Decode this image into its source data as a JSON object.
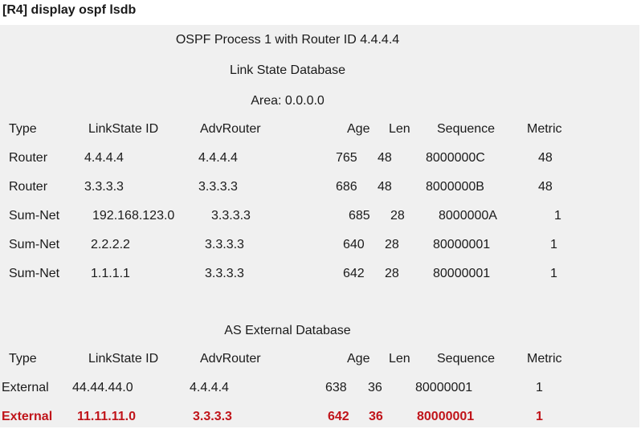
{
  "command": "[R4] display ospf lsdb",
  "header": {
    "process_line": "OSPF Process 1 with Router ID 4.4.4.4",
    "lsdb_title": "Link State Database",
    "area": "Area: 0.0.0.0"
  },
  "columns": {
    "type": "Type",
    "ls_id": "LinkState ID",
    "adv_router": "AdvRouter",
    "age": "Age",
    "len": "Len",
    "sequence": "Sequence",
    "metric": "Metric"
  },
  "area_rows": [
    {
      "type": "Router",
      "ls_id": "4.4.4.4",
      "adv_router": "4.4.4.4",
      "age": "765",
      "len": "48",
      "sequence": "8000000C",
      "metric": "48"
    },
    {
      "type": "Router",
      "ls_id": "3.3.3.3",
      "adv_router": "3.3.3.3",
      "age": "686",
      "len": "48",
      "sequence": "8000000B",
      "metric": "48"
    },
    {
      "type": "Sum-Net",
      "ls_id": "192.168.123.0",
      "adv_router": "3.3.3.3",
      "age": "685",
      "len": "28",
      "sequence": "8000000A",
      "metric": "1"
    },
    {
      "type": "Sum-Net",
      "ls_id": "2.2.2.2",
      "adv_router": "3.3.3.3",
      "age": "640",
      "len": "28",
      "sequence": "80000001",
      "metric": "1"
    },
    {
      "type": "Sum-Net",
      "ls_id": "1.1.1.1",
      "adv_router": "3.3.3.3",
      "age": "642",
      "len": "28",
      "sequence": "80000001",
      "metric": "1"
    }
  ],
  "external": {
    "title": "AS External Database",
    "rows": [
      {
        "type": "External",
        "ls_id": "44.44.44.0",
        "adv_router": "4.4.4.4",
        "age": "638",
        "len": "36",
        "sequence": "80000001",
        "metric": "1",
        "highlight": false
      },
      {
        "type": "External",
        "ls_id": "11.11.11.0",
        "adv_router": "3.3.3.3",
        "age": "642",
        "len": "36",
        "sequence": "80000001",
        "metric": "1",
        "highlight": true
      }
    ]
  },
  "colors": {
    "highlight": "#c0141a",
    "panel_bg": "#f0f0f0"
  }
}
